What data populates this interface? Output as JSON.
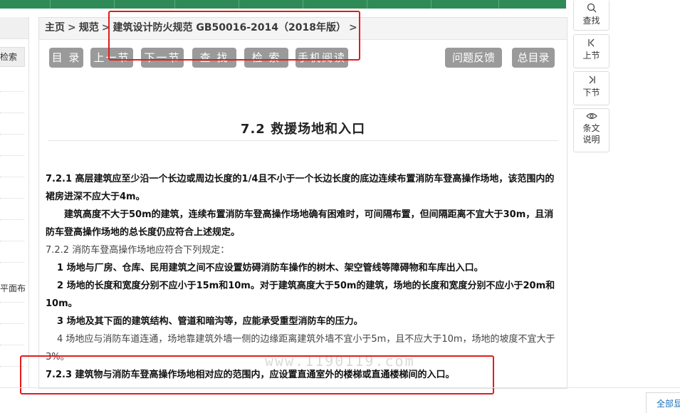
{
  "breadcrumb": {
    "home": "主页",
    "sep": ">",
    "spec": "规范",
    "title": "建筑设计防火规范 GB50016-2014（2018年版）"
  },
  "toolbar": {
    "catalog": "目 录",
    "prev": "上一节",
    "next": "下一节",
    "find": "查 找",
    "search": "检 索",
    "mobile": "手机阅读",
    "feedback": "问题反馈",
    "all_catalog": "总目录"
  },
  "section_title": "7.2  救援场地和入口",
  "content": {
    "p1": "7.2.1 高层建筑应至少沿一个长边或周边长度的1/4且不小于一个长边长度的底边连续布置消防车登高操作场地，该范围内的裙房进深不应大于4m。",
    "p2": "建筑高度不大于50m的建筑，连续布置消防车登高操作场地确有困难时，可间隔布置，但间隔距离不宜大于30m，且消防车登高操作场地的总长度仍应符合上述规定。",
    "p3": "7.2.2 消防车登高操作场地应符合下列规定：",
    "p4": "1 场地与厂房、仓库、民用建筑之间不应设置妨碍消防车操作的树木、架空管线等障碍物和车库出入口。",
    "p5": "2 场地的长度和宽度分别不应小于15m和10m。对于建筑高度大于50m的建筑，场地的长度和宽度分别不应小于20m和10m。",
    "p6": "3 场地及其下面的建筑结构、管道和暗沟等，应能承受重型消防车的压力。",
    "p7": "4 场地应与消防车道连通，场地靠建筑外墙一侧的边缘距离建筑外墙不宜小于5m，且不应大于10m，场地的坡度不宜大于3%。",
    "p8": "7.2.3 建筑物与消防车登高操作场地相对应的范围内，应设置直通室外的楼梯或直通楼梯间的入口。"
  },
  "watermark": "www.1190119.com",
  "sidebar": {
    "search_label": "检索",
    "item_text": "平面布"
  },
  "right_tools": {
    "find": "查找",
    "prev": "上节",
    "next": "下节",
    "explain_1": "条文",
    "explain_2": "说明"
  },
  "bottom": {
    "show_all": "全部显"
  },
  "colors": {
    "nav_green": "#2e8b57",
    "button_gray": "#9a9a9a",
    "annotation_red": "#e41b1b"
  }
}
